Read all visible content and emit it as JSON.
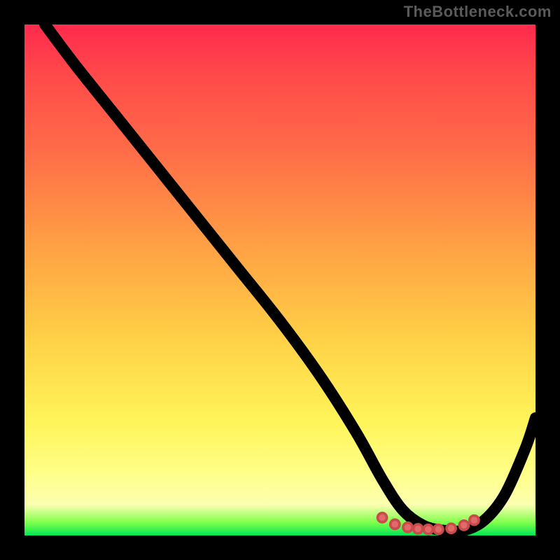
{
  "watermark_text": "TheBottleneck.com",
  "chart_data": {
    "type": "line",
    "title": "",
    "xlabel": "",
    "ylabel": "",
    "x_range": [
      0,
      100
    ],
    "y_range": [
      0,
      100
    ],
    "series": [
      {
        "name": "bottleneck-curve",
        "x": [
          4,
          10,
          18,
          26,
          34,
          42,
          50,
          58,
          65,
          70,
          74,
          78,
          82,
          86,
          90,
          94,
          98,
          100
        ],
        "y": [
          100,
          92,
          82,
          72,
          62,
          52,
          42,
          31,
          20,
          11,
          5,
          2,
          1,
          1,
          3,
          8,
          17,
          23
        ]
      }
    ],
    "flat_bottom_dots": {
      "name": "optimum-markers",
      "x": [
        70,
        72.5,
        75,
        77,
        79,
        81,
        83.5,
        86,
        88
      ],
      "y": [
        3.5,
        2.2,
        1.6,
        1.3,
        1.2,
        1.2,
        1.4,
        2.0,
        3.0
      ]
    },
    "gradient_stops": [
      {
        "pos": 0,
        "color": "#ff2a4d"
      },
      {
        "pos": 10,
        "color": "#ff4a4a"
      },
      {
        "pos": 25,
        "color": "#ff6d48"
      },
      {
        "pos": 45,
        "color": "#ffa544"
      },
      {
        "pos": 62,
        "color": "#ffd247"
      },
      {
        "pos": 78,
        "color": "#fff55a"
      },
      {
        "pos": 88,
        "color": "#ffff8a"
      },
      {
        "pos": 94,
        "color": "#fcffb0"
      },
      {
        "pos": 97.5,
        "color": "#7dff4a"
      },
      {
        "pos": 100,
        "color": "#00e756"
      }
    ]
  }
}
